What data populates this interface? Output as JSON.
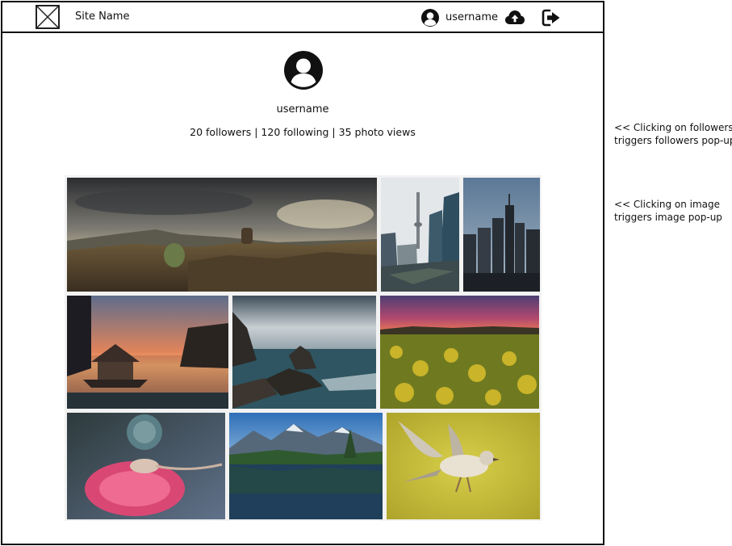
{
  "header": {
    "site_name": "Site Name",
    "username": "username"
  },
  "profile": {
    "username": "username",
    "followers": "20 followers",
    "following": "120 following",
    "photo_views": "35 photo views",
    "separator": " | "
  },
  "gallery": {
    "photos": [
      "landscape-rock-sunset",
      "city-tower-tilted",
      "city-skyline-night",
      "gazebo-lake-sunset",
      "rocky-coast-waves",
      "rapeseed-field-sunset",
      "lizard-on-thistle",
      "mountain-lake-reflection",
      "bird-in-flight"
    ]
  },
  "annotations": {
    "followers_line1": "<< Clicking on followers",
    "followers_line2": "triggers followers pop-up",
    "image_line1": "<< Clicking on image",
    "image_line2": "triggers image pop-up"
  }
}
